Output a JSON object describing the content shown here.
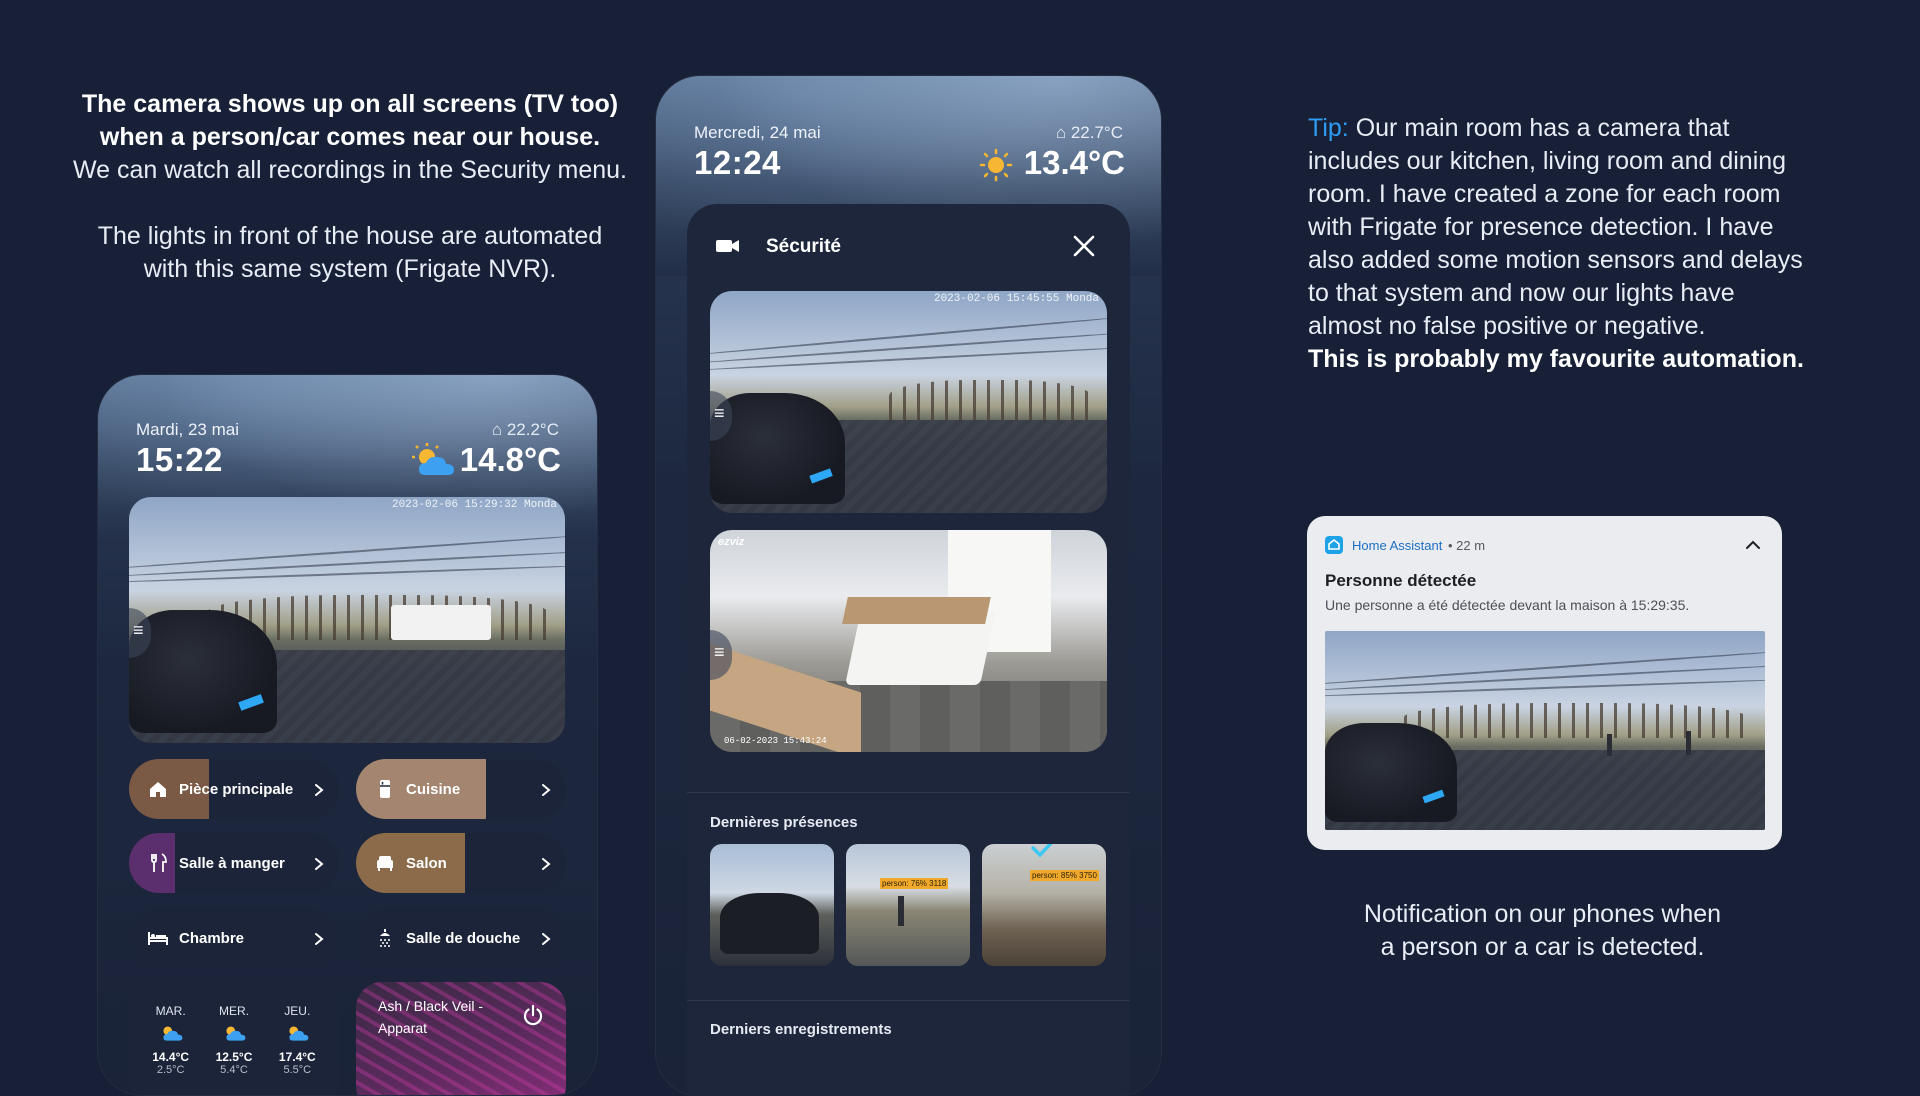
{
  "left_caption": {
    "line1": "The camera shows up on all screens (TV too)",
    "line2": "when a person/car comes near our house.",
    "line3": "We can watch all recordings in the Security menu.",
    "line4": "The lights in front of the house are automated",
    "line5": "with this same system (Frigate NVR)."
  },
  "phone_left": {
    "date": "Mardi, 23 mai",
    "time": "15:22",
    "indoor_temp": "⌂ 22.2°C",
    "outdoor_temp": "14.8°C",
    "weather_icon": "partly-cloudy-icon",
    "camera_stamp": "2023-02-06 15:29:32 Monda",
    "rooms": [
      {
        "label": "Pièce principale",
        "icon": "home-icon",
        "fill_color": "#7a5a45",
        "fill_fraction": 0.38
      },
      {
        "label": "Cuisine",
        "icon": "fridge-icon",
        "fill_color": "#a48670",
        "fill_fraction": 0.62
      },
      {
        "label": "Salle à manger",
        "icon": "utensils-icon",
        "fill_color": "#5b2f6e",
        "fill_fraction": 0.22
      },
      {
        "label": "Salon",
        "icon": "sofa-icon",
        "fill_color": "#8c6b4a",
        "fill_fraction": 0.52
      },
      {
        "label": "Chambre",
        "icon": "bed-icon",
        "fill_color": "#1c2439",
        "fill_fraction": 0
      },
      {
        "label": "Salle de douche",
        "icon": "shower-icon",
        "fill_color": "#1c2439",
        "fill_fraction": 0
      }
    ],
    "forecast": [
      {
        "day": "MAR.",
        "high": "14.4°C",
        "low": "2.5°C"
      },
      {
        "day": "MER.",
        "high": "12.5°C",
        "low": "5.4°C"
      },
      {
        "day": "JEU.",
        "high": "17.4°C",
        "low": "5.5°C"
      }
    ],
    "media": {
      "title": "Ash / Black Veil -",
      "subtitle": "Apparat"
    }
  },
  "phone_middle": {
    "date": "Mercredi, 24 mai",
    "time": "12:24",
    "indoor_temp": "⌂ 22.7°C",
    "outdoor_temp": "13.4°C",
    "weather_icon": "sun-icon",
    "panel_title": "Sécurité",
    "camera1_stamp": "2023-02-06 15:45:55 Monda",
    "camera2_brand": "ezviz",
    "camera2_stamp": "06-02-2023 15:43:24",
    "recent_presences_title": "Dernières présences",
    "thumb_labels": [
      "",
      "person: 76% 3118",
      "person: 85% 3750"
    ],
    "recent_recordings_title": "Derniers enregistrements"
  },
  "tip": {
    "tag": "Tip:",
    "text": " Our main room has a camera that includes our kitchen, living room and dining room. I have created a zone for each room with Frigate for presence detection. I have also added some motion sensors and delays to that system and now our lights have almost no false positive or negative.",
    "bold": "This is probably my favourite automation."
  },
  "notification": {
    "app": "Home Assistant",
    "age": "• 22 m",
    "title": "Personne détectée",
    "body": "Une personne a été détectée devant la maison à 15:29:35."
  },
  "right_caption": {
    "line1": "Notification on our phones when",
    "line2": "a person or a car is detected."
  }
}
